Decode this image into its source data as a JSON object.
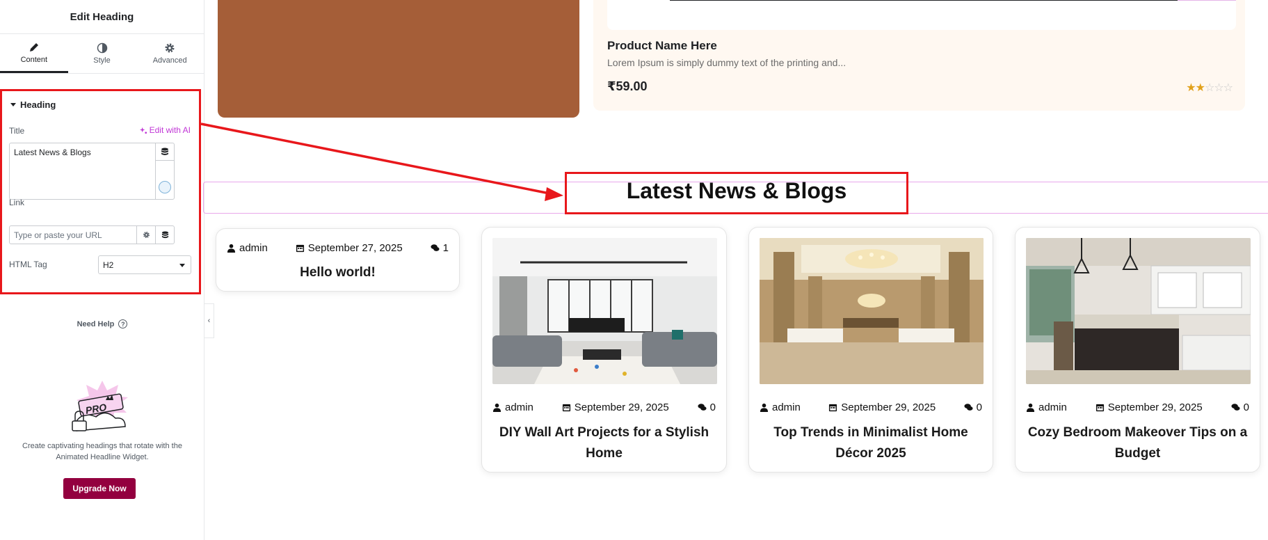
{
  "panel": {
    "title": "Edit Heading",
    "tabs": [
      {
        "label": "Content",
        "icon": "pencil-icon"
      },
      {
        "label": "Style",
        "icon": "half-circle-icon"
      },
      {
        "label": "Advanced",
        "icon": "gear-icon"
      }
    ],
    "section": {
      "heading": "Heading",
      "title_label": "Title",
      "edit_ai_label": "Edit with AI",
      "title_value": "Latest News & Blogs",
      "link_label": "Link",
      "link_placeholder": "Type or paste your URL",
      "html_tag_label": "HTML Tag",
      "html_tag_value": "H2"
    },
    "need_help": "Need Help",
    "promo_text": "Create captivating headings that rotate with the Animated Headline Widget.",
    "upgrade_label": "Upgrade Now",
    "pro_badge": "PRO",
    "accent_color": "#93003f"
  },
  "product": {
    "name": "Product Name Here",
    "description": "Lorem Ipsum is simply dummy text of the printing and...",
    "price": "₹59.00",
    "rating": 2,
    "max_rating": 5
  },
  "blog": {
    "heading": "Latest News & Blogs",
    "posts": [
      {
        "author": "admin",
        "date": "September 27, 2025",
        "comments": "1",
        "title": "Hello world!",
        "has_image": false
      },
      {
        "author": "admin",
        "date": "September 29, 2025",
        "comments": "0",
        "title": "DIY Wall Art Projects for a Stylish Home",
        "has_image": true
      },
      {
        "author": "admin",
        "date": "September 29, 2025",
        "comments": "0",
        "title": "Top Trends in Minimalist Home Décor 2025",
        "has_image": true
      },
      {
        "author": "admin",
        "date": "September 29, 2025",
        "comments": "0",
        "title": "Cozy Bedroom Makeover Tips on a Budget",
        "has_image": true
      }
    ]
  },
  "colors": {
    "highlight": "#e8171b",
    "product_bg": "#fff8f1",
    "brown_block": "#a55e38",
    "star": "#e1a11a"
  }
}
